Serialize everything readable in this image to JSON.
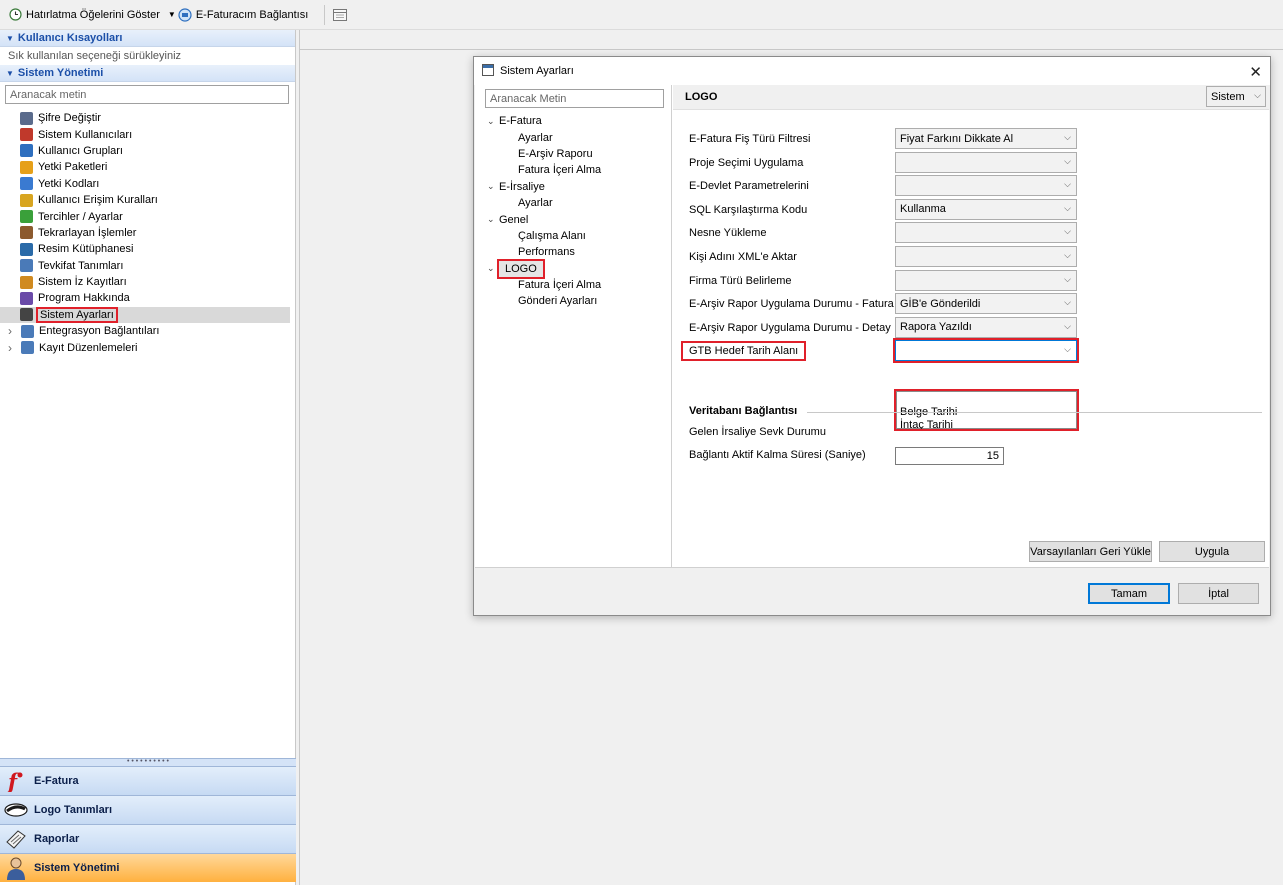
{
  "toolbar": {
    "reminders_label": "Hatırlatma Öğelerini Göster",
    "efatura_conn_label": "E-Faturacım Bağlantısı"
  },
  "left": {
    "shortcuts_header": "Kullanıcı Kısayolları",
    "shortcuts_hint": "Sık kullanılan seçeneği sürükleyiniz",
    "sysmgmt_header": "Sistem Yönetimi",
    "search_placeholder": "Aranacak metin",
    "items": [
      {
        "label": "Şifre Değiştir",
        "icon": "password-icon",
        "color": "#5a6b8c"
      },
      {
        "label": "Sistem Kullanıcıları",
        "icon": "users-icon",
        "color": "#c0392b"
      },
      {
        "label": "Kullanıcı Grupları",
        "icon": "user-group-icon",
        "color": "#2e6fbf"
      },
      {
        "label": "Yetki Paketleri",
        "icon": "key-icon",
        "color": "#e6a019"
      },
      {
        "label": "Yetki Kodları",
        "icon": "key-icon",
        "color": "#3a7ad1"
      },
      {
        "label": "Kullanıcı Erişim Kuralları",
        "icon": "rules-icon",
        "color": "#d8a520"
      },
      {
        "label": "Tercihler / Ayarlar",
        "icon": "preferences-icon",
        "color": "#3aa03a"
      },
      {
        "label": "Tekrarlayan İşlemler",
        "icon": "recurring-icon",
        "color": "#8c5a2e"
      },
      {
        "label": "Resim Kütüphanesi",
        "icon": "image-library-icon",
        "color": "#2a6aa8"
      },
      {
        "label": "Tevkifat Tanımları",
        "icon": "table-icon",
        "color": "#4a7ab8"
      },
      {
        "label": "Sistem İz Kayıtları",
        "icon": "log-icon",
        "color": "#d08a20"
      },
      {
        "label": "Program Hakkında",
        "icon": "about-icon",
        "color": "#6a4aa8"
      },
      {
        "label": "Sistem Ayarları",
        "icon": "gear-icon",
        "color": "#444444"
      },
      {
        "label": "Entegrasyon Bağlantıları",
        "icon": "integration-icon",
        "color": "#4a7ab8"
      },
      {
        "label": "Kayıt Düzenlemeleri",
        "icon": "record-edit-icon",
        "color": "#4a7ab8"
      }
    ]
  },
  "bottom_nav": [
    {
      "label": "E-Fatura",
      "icon": "efatura-icon"
    },
    {
      "label": "Logo Tanımları",
      "icon": "logo-icon"
    },
    {
      "label": "Raporlar",
      "icon": "reports-icon"
    },
    {
      "label": "Sistem Yönetimi",
      "icon": "admin-icon"
    }
  ],
  "dialog": {
    "title": "Sistem Ayarları",
    "search_placeholder": "Aranacak Metin",
    "tree": [
      {
        "label": "E-Fatura",
        "level": 0
      },
      {
        "label": "Ayarlar",
        "level": 1
      },
      {
        "label": "E-Arşiv Raporu",
        "level": 1
      },
      {
        "label": "Fatura İçeri Alma",
        "level": 1
      },
      {
        "label": "E-İrsaliye",
        "level": 0
      },
      {
        "label": "Ayarlar",
        "level": 1
      },
      {
        "label": "Genel",
        "level": 0
      },
      {
        "label": "Çalışma Alanı",
        "level": 1
      },
      {
        "label": "Performans",
        "level": 1
      },
      {
        "label": "LOGO",
        "level": 0
      },
      {
        "label": "Fatura İçeri Alma",
        "level": 1
      },
      {
        "label": "Gönderi Ayarları",
        "level": 1
      }
    ],
    "section_title": "LOGO",
    "scope_value": "Sistem",
    "rows": [
      {
        "label": "E-Fatura Fiş Türü Filtresi",
        "value": "Fiyat Farkını Dikkate Al"
      },
      {
        "label": "Proje Seçimi Uygulama",
        "value": ""
      },
      {
        "label": "E-Devlet Parametrelerini",
        "value": ""
      },
      {
        "label": "SQL Karşılaştırma Kodu",
        "value": "Kullanma"
      },
      {
        "label": "Nesne Yükleme",
        "value": ""
      },
      {
        "label": "Kişi Adını XML'e Aktar",
        "value": ""
      },
      {
        "label": "Firma Türü Belirleme",
        "value": ""
      },
      {
        "label": "E-Arşiv Rapor Uygulama Durumu - Fatura",
        "value": "GİB'e Gönderildi"
      },
      {
        "label": "E-Arşiv Rapor Uygulama Durumu - Detay",
        "value": "Rapora Yazıldı"
      },
      {
        "label": "GTB Hedef Tarih Alanı",
        "value": ""
      }
    ],
    "dropdown_options": [
      "Belge Tarihi",
      "İntaç Tarihi"
    ],
    "db_group_title": "Veritabanı Bağlantısı",
    "db_rows": [
      {
        "label": "Gelen İrsaliye Sevk Durumu"
      },
      {
        "label": "Bağlantı Aktif Kalma Süresi (Saniye)",
        "value": "15"
      }
    ],
    "btn_defaults": "Varsayılanları Geri Yükle",
    "btn_apply": "Uygula",
    "btn_ok": "Tamam",
    "btn_cancel": "İptal"
  }
}
